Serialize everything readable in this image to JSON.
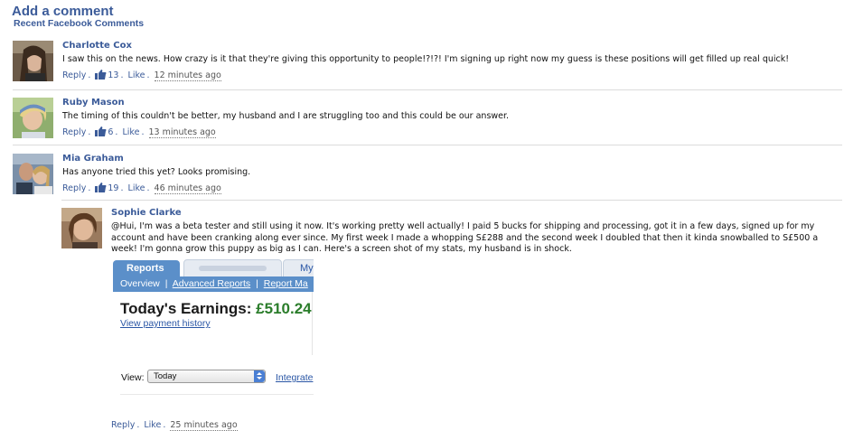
{
  "header": {
    "title": "Add a comment",
    "subtitle": "Recent Facebook Comments"
  },
  "comments": [
    {
      "name": "Charlotte Cox",
      "text": "I saw this on the news. How crazy is it that they're giving this opportunity to people!?!?! I'm signing up right now my guess is these positions will get filled up real quick!",
      "reply": "Reply",
      "likes": "13",
      "like": "Like",
      "time": "12 minutes ago"
    },
    {
      "name": "Ruby Mason",
      "text": "The timing of this couldn't be better, my husband and I are struggling too and this could be our answer.",
      "reply": "Reply",
      "likes": "6",
      "like": "Like",
      "time": "13 minutes ago"
    },
    {
      "name": "Mia Graham",
      "text": "Has anyone tried this yet? Looks promising.",
      "reply": "Reply",
      "likes": "19",
      "like": "Like",
      "time": "46 minutes ago"
    }
  ],
  "reply_comment": {
    "name": "Sophie Clarke",
    "text": "@Hui, I'm was a beta tester and still using it now. It's working pretty well actually! I paid 5 bucks for shipping and processing, got it in a few days, signed up for my account and have been cranking along ever since. My first week I made a whopping S£288 and the second week I doubled that then it kinda snowballed to S£500 a week! I'm gonna grow this puppy as big as I can. Here's a screen shot of my stats, my husband is in shock.",
    "reply": "Reply",
    "like": "Like",
    "time": "25 minutes ago"
  },
  "screenshot": {
    "tab_active": "Reports",
    "tab_partial": "My",
    "sub_overview": "Overview",
    "sub_advanced": "Advanced Reports",
    "sub_report": "Report Ma",
    "earnings_label": "Today's Earnings:",
    "earnings_value": "£510.24",
    "payment_history": "View payment history",
    "view_label": "View:",
    "view_value": "Today",
    "integrate": "Integrate"
  },
  "colors": {
    "link": "#3b5b99",
    "tab_blue": "#5b8fc9",
    "earnings_green": "#2b7d2b"
  },
  "icons": [
    "thumbs-up-icon",
    "dropdown-arrow-icon"
  ]
}
